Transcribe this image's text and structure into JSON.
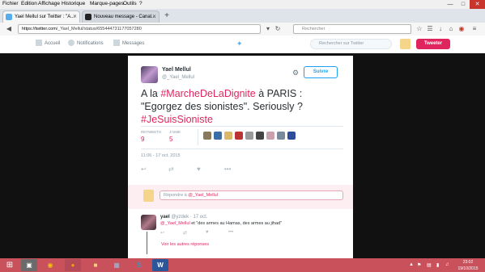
{
  "menubar": {
    "items": [
      "Fichier",
      "Edition",
      "Affichage",
      "Historique",
      "Marque-pages",
      "Outils",
      "?"
    ]
  },
  "browser": {
    "tabs": [
      {
        "label": "Yael Mellul sur Twitter : \"A..."
      },
      {
        "label": "Nouveau message - Canal..."
      }
    ],
    "url_host": "https://twitter.com",
    "url_path": "/_Yael_Mellul/status/655444731177057280",
    "search_placeholder": "Rechercher"
  },
  "twitter_nav": {
    "home": "Accueil",
    "notifications": "Notifications",
    "messages": "Messages",
    "search_placeholder": "Rechercher sur Twitter",
    "tweet_button": "Tweeter"
  },
  "tweet": {
    "name": "Yael Mellul",
    "handle": "@_Yael_Mellul",
    "follow_label": "Suivre",
    "text_prefix": "A la ",
    "hashtag1": "#MarcheDeLaDignite",
    "text_mid": " à PARIS : \"Egorgez des sionistes\". Seriously ? ",
    "hashtag2": "#JeSuisSioniste",
    "retweets_label": "RETWEETS",
    "retweets_value": "9",
    "likes_label": "J'AIME",
    "likes_value": "5",
    "timestamp": "11:06 - 17 oct. 2015"
  },
  "reply_box": {
    "placeholder_prefix": "Répondre à ",
    "mention": "@_Yael_Mellul"
  },
  "reply": {
    "name": "yael",
    "handle_time": "@yzdek · 17 oct.",
    "mention": "@_Yael_Mellul",
    "text": " et \"des armes au Hamas, des armes au jihad\"",
    "more": "Voir les autres réponses"
  },
  "taskbar": {
    "time": "23:02",
    "date": "19/10/2015"
  },
  "colors": {
    "accent": "#e0245e",
    "twitter_blue": "#1da1f2",
    "taskbar": "#c8515c"
  }
}
